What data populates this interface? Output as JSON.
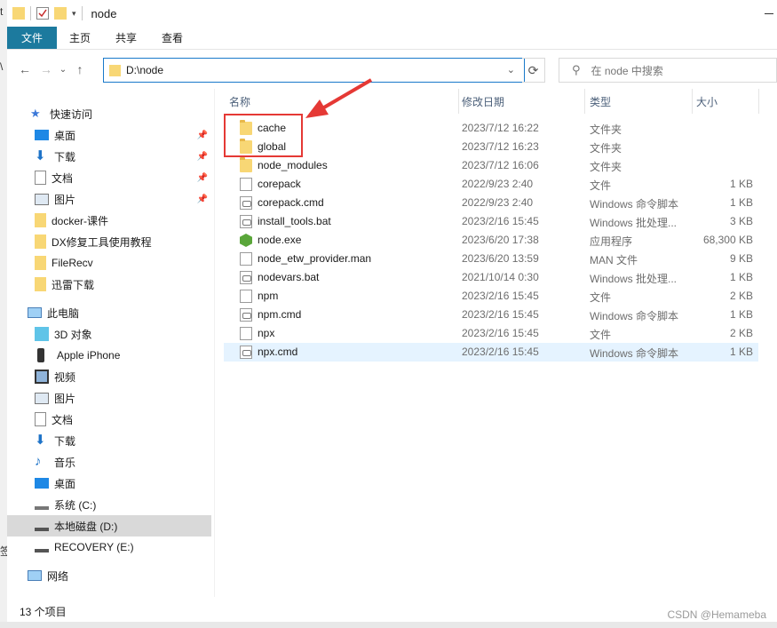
{
  "window": {
    "title": "node"
  },
  "ribbon": {
    "tabs": [
      "文件",
      "主页",
      "共享",
      "查看"
    ]
  },
  "address": {
    "path": "D:\\node",
    "search_placeholder": "在 node 中搜索"
  },
  "nav": {
    "quick_access": "快速访问",
    "quick_items": [
      {
        "label": "桌面",
        "pinned": true
      },
      {
        "label": "下载",
        "pinned": true
      },
      {
        "label": "文档",
        "pinned": true
      },
      {
        "label": "图片",
        "pinned": true
      },
      {
        "label": "docker-课件",
        "pinned": false
      },
      {
        "label": "DX修复工具使用教程",
        "pinned": false
      },
      {
        "label": "FileRecv",
        "pinned": false
      },
      {
        "label": "迅雷下载",
        "pinned": false
      }
    ],
    "this_pc": "此电脑",
    "pc_items": [
      {
        "label": "3D 对象"
      },
      {
        "label": "Apple iPhone"
      },
      {
        "label": "视频"
      },
      {
        "label": "图片"
      },
      {
        "label": "文档"
      },
      {
        "label": "下载"
      },
      {
        "label": "音乐"
      },
      {
        "label": "桌面"
      },
      {
        "label": "系统 (C:)"
      },
      {
        "label": "本地磁盘 (D:)"
      },
      {
        "label": "RECOVERY (E:)"
      }
    ],
    "network": "网络"
  },
  "columns": {
    "name": "名称",
    "date": "修改日期",
    "type": "类型",
    "size": "大小"
  },
  "files": [
    {
      "name": "cache",
      "date": "2023/7/12 16:22",
      "type": "文件夹",
      "size": "",
      "icon": "folder-icon"
    },
    {
      "name": "global",
      "date": "2023/7/12 16:23",
      "type": "文件夹",
      "size": "",
      "icon": "folder-icon"
    },
    {
      "name": "node_modules",
      "date": "2023/7/12 16:06",
      "type": "文件夹",
      "size": "",
      "icon": "folder-icon"
    },
    {
      "name": "corepack",
      "date": "2022/9/23 2:40",
      "type": "文件",
      "size": "1 KB",
      "icon": "file-icon"
    },
    {
      "name": "corepack.cmd",
      "date": "2022/9/23 2:40",
      "type": "Windows 命令脚本",
      "size": "1 KB",
      "icon": "cmd-icon"
    },
    {
      "name": "install_tools.bat",
      "date": "2023/2/16 15:45",
      "type": "Windows 批处理...",
      "size": "3 KB",
      "icon": "cmd-icon"
    },
    {
      "name": "node.exe",
      "date": "2023/6/20 17:38",
      "type": "应用程序",
      "size": "68,300 KB",
      "icon": "exe-icon"
    },
    {
      "name": "node_etw_provider.man",
      "date": "2023/6/20 13:59",
      "type": "MAN 文件",
      "size": "9 KB",
      "icon": "file-icon"
    },
    {
      "name": "nodevars.bat",
      "date": "2021/10/14 0:30",
      "type": "Windows 批处理...",
      "size": "1 KB",
      "icon": "cmd-icon"
    },
    {
      "name": "npm",
      "date": "2023/2/16 15:45",
      "type": "文件",
      "size": "2 KB",
      "icon": "file-icon"
    },
    {
      "name": "npm.cmd",
      "date": "2023/2/16 15:45",
      "type": "Windows 命令脚本",
      "size": "1 KB",
      "icon": "cmd-icon"
    },
    {
      "name": "npx",
      "date": "2023/2/16 15:45",
      "type": "文件",
      "size": "2 KB",
      "icon": "file-icon"
    },
    {
      "name": "npx.cmd",
      "date": "2023/2/16 15:45",
      "type": "Windows 命令脚本",
      "size": "1 KB",
      "icon": "cmd-icon"
    }
  ],
  "status": {
    "count": "13 个项目"
  },
  "watermark": "CSDN @Hemameba",
  "background_fragments": [
    "t",
    "\\",
    "签"
  ],
  "colors": {
    "file_tab": "#1c7a9e",
    "selection": "#cce8ff",
    "highlight_box": "#e53935"
  }
}
